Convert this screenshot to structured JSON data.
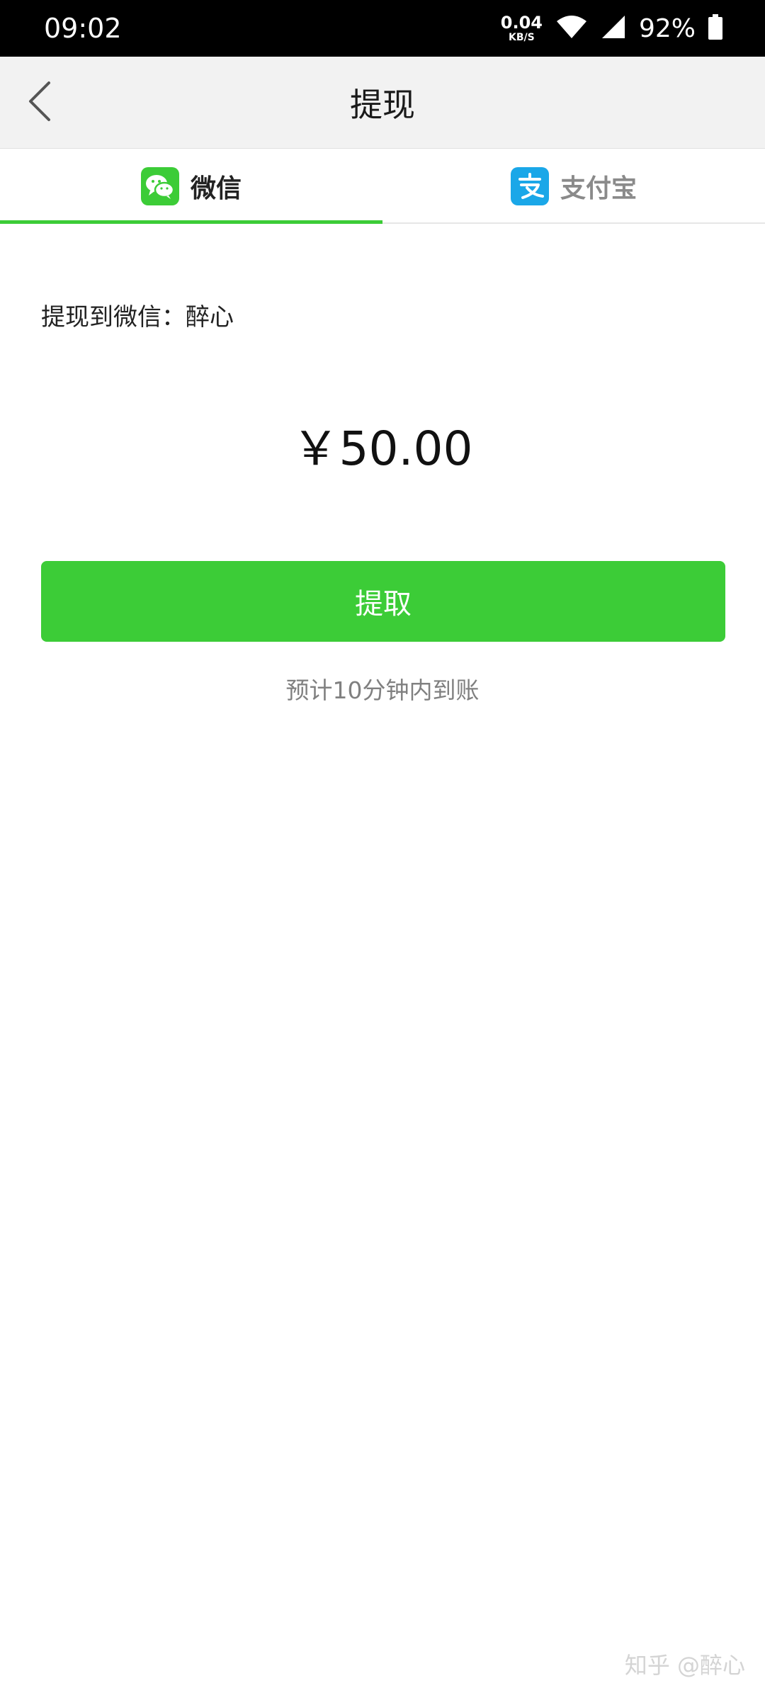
{
  "status_bar": {
    "time": "09:02",
    "net_speed_value": "0.04",
    "net_speed_unit": "KB/S",
    "battery": "92%"
  },
  "title_bar": {
    "title": "提现",
    "back_icon": "chevron-left-icon"
  },
  "tabs": [
    {
      "label": "微信",
      "icon": "wechat-icon",
      "active": true,
      "color": "#3ccc37"
    },
    {
      "label": "支付宝",
      "icon": "alipay-icon",
      "active": false,
      "color": "#1aa7e8"
    }
  ],
  "content": {
    "recipient": "提现到微信：醉心",
    "amount": "￥50.00",
    "button_label": "提取",
    "eta_text": "预计10分钟内到账"
  },
  "watermark": "知乎 @醉心",
  "colors": {
    "accent": "#3ccc37",
    "alipay": "#1aa7e8"
  }
}
